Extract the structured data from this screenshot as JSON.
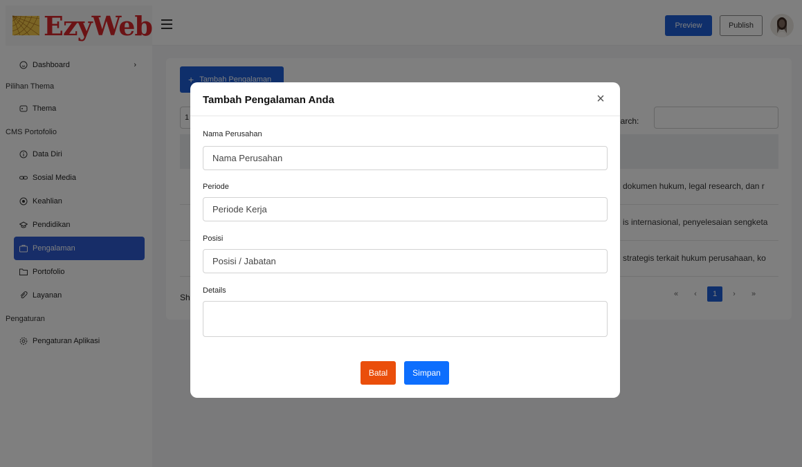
{
  "header": {
    "logo_text": "EzyWeb",
    "preview_label": "Preview",
    "publish_label": "Publish"
  },
  "sidebar": {
    "dashboard": "Dashboard",
    "section_theme": "Pilihan Thema",
    "theme": "Thema",
    "section_cms": "CMS Portofolio",
    "data_diri": "Data Diri",
    "sosial_media": "Sosial Media",
    "keahlian": "Keahlian",
    "pendidikan": "Pendidikan",
    "pengalaman": "Pengalaman",
    "portofolio": "Portofolio",
    "layanan": "Layanan",
    "section_settings": "Pengaturan",
    "pengaturan_aplikasi": "Pengaturan Aplikasi"
  },
  "main": {
    "add_button": "Tambah Pengalaman",
    "length_value": "1",
    "search_label": "earch:",
    "rows": [
      "dokumen hukum, legal research, dan r",
      "is internasional, penyelesaian sengketa",
      "strategis terkait hukum perusahaan, ko"
    ],
    "info_text": "Sh",
    "pager": {
      "first": "«",
      "prev": "‹",
      "current": "1",
      "next": "›",
      "last": "»"
    }
  },
  "modal": {
    "title": "Tambah Pengalaman Anda",
    "close_icon": "×",
    "company_label": "Nama Perusahan",
    "company_placeholder": "Nama Perusahan",
    "period_label": "Periode",
    "period_placeholder": "Periode Kerja",
    "position_label": "Posisi",
    "position_placeholder": "Posisi / Jabatan",
    "details_label": "Details",
    "cancel_label": "Batal",
    "save_label": "Simpan"
  },
  "colors": {
    "primary": "#1f5fd6",
    "active_sidebar": "#2f5bd0",
    "danger": "#ea4e0b",
    "save": "#0d6efd",
    "logo": "#d7262b"
  }
}
